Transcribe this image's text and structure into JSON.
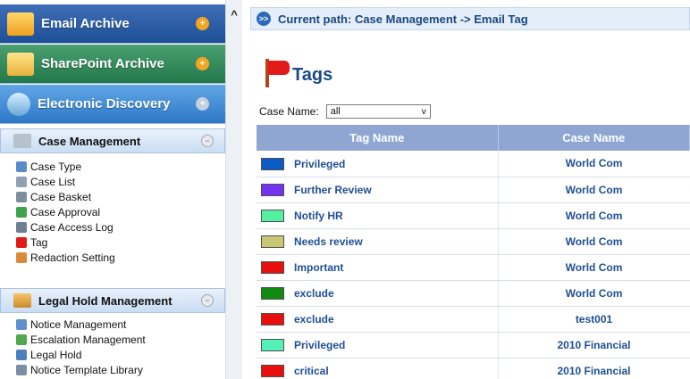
{
  "sidebar": {
    "modules": [
      {
        "label": "Email Archive",
        "icon": "envelope-icon",
        "toggle": "+"
      },
      {
        "label": "SharePoint Archive",
        "icon": "folder-icon",
        "toggle": "+"
      },
      {
        "label": "Electronic Discovery",
        "icon": "magnifier-icon",
        "toggle": "+"
      }
    ],
    "case_section": {
      "label": "Case Management",
      "items": [
        {
          "label": "Case Type",
          "icon": "case-type-icon",
          "color": "#5a8bc7"
        },
        {
          "label": "Case List",
          "icon": "case-list-icon",
          "color": "#8fa1b3"
        },
        {
          "label": "Case Basket",
          "icon": "case-basket-icon",
          "color": "#7c8f9e"
        },
        {
          "label": "Case Approval",
          "icon": "case-approval-icon",
          "color": "#3fa34d"
        },
        {
          "label": "Case Access Log",
          "icon": "access-log-icon",
          "color": "#6e7f91"
        },
        {
          "label": "Tag",
          "icon": "red-flag-icon",
          "color": "#e11a1a"
        },
        {
          "label": "Redaction Setting",
          "icon": "redaction-icon",
          "color": "#d98a3a"
        }
      ]
    },
    "legal_section": {
      "label": "Legal Hold Management",
      "items": [
        {
          "label": "Notice Management",
          "icon": "notice-icon",
          "color": "#5f8fcc"
        },
        {
          "label": "Escalation Management",
          "icon": "escalation-icon",
          "color": "#4fa84b"
        },
        {
          "label": "Legal Hold",
          "icon": "legal-hold-icon",
          "color": "#4a7fc0"
        },
        {
          "label": "Notice Template Library",
          "icon": "template-icon",
          "color": "#7a8fa5"
        }
      ]
    }
  },
  "collapse_glyph": "^",
  "path": {
    "text": "Current path: Case Management -> Email Tag",
    "icon": ">>"
  },
  "page_title": "Tags",
  "filter": {
    "label": "Case Name:",
    "value": "all",
    "chevron": "v"
  },
  "table": {
    "headers": [
      "Tag Name",
      "Case Name"
    ],
    "rows": [
      {
        "color": "#0d5cc4",
        "tag": "Privileged",
        "case": "World Com"
      },
      {
        "color": "#7433f0",
        "tag": "Further Review",
        "case": "World Com"
      },
      {
        "color": "#54f0a2",
        "tag": "Notify HR",
        "case": "World Com"
      },
      {
        "color": "#c9c676",
        "tag": "Needs review",
        "case": "World Com"
      },
      {
        "color": "#e80f0f",
        "tag": "Important",
        "case": "World Com"
      },
      {
        "color": "#108a10",
        "tag": "exclude",
        "case": "World Com"
      },
      {
        "color": "#e80f0f",
        "tag": "exclude",
        "case": "test001"
      },
      {
        "color": "#54f0b8",
        "tag": "Privileged",
        "case": "2010 Financial"
      },
      {
        "color": "#e80f0f",
        "tag": "critical",
        "case": "2010 Financial"
      }
    ]
  }
}
